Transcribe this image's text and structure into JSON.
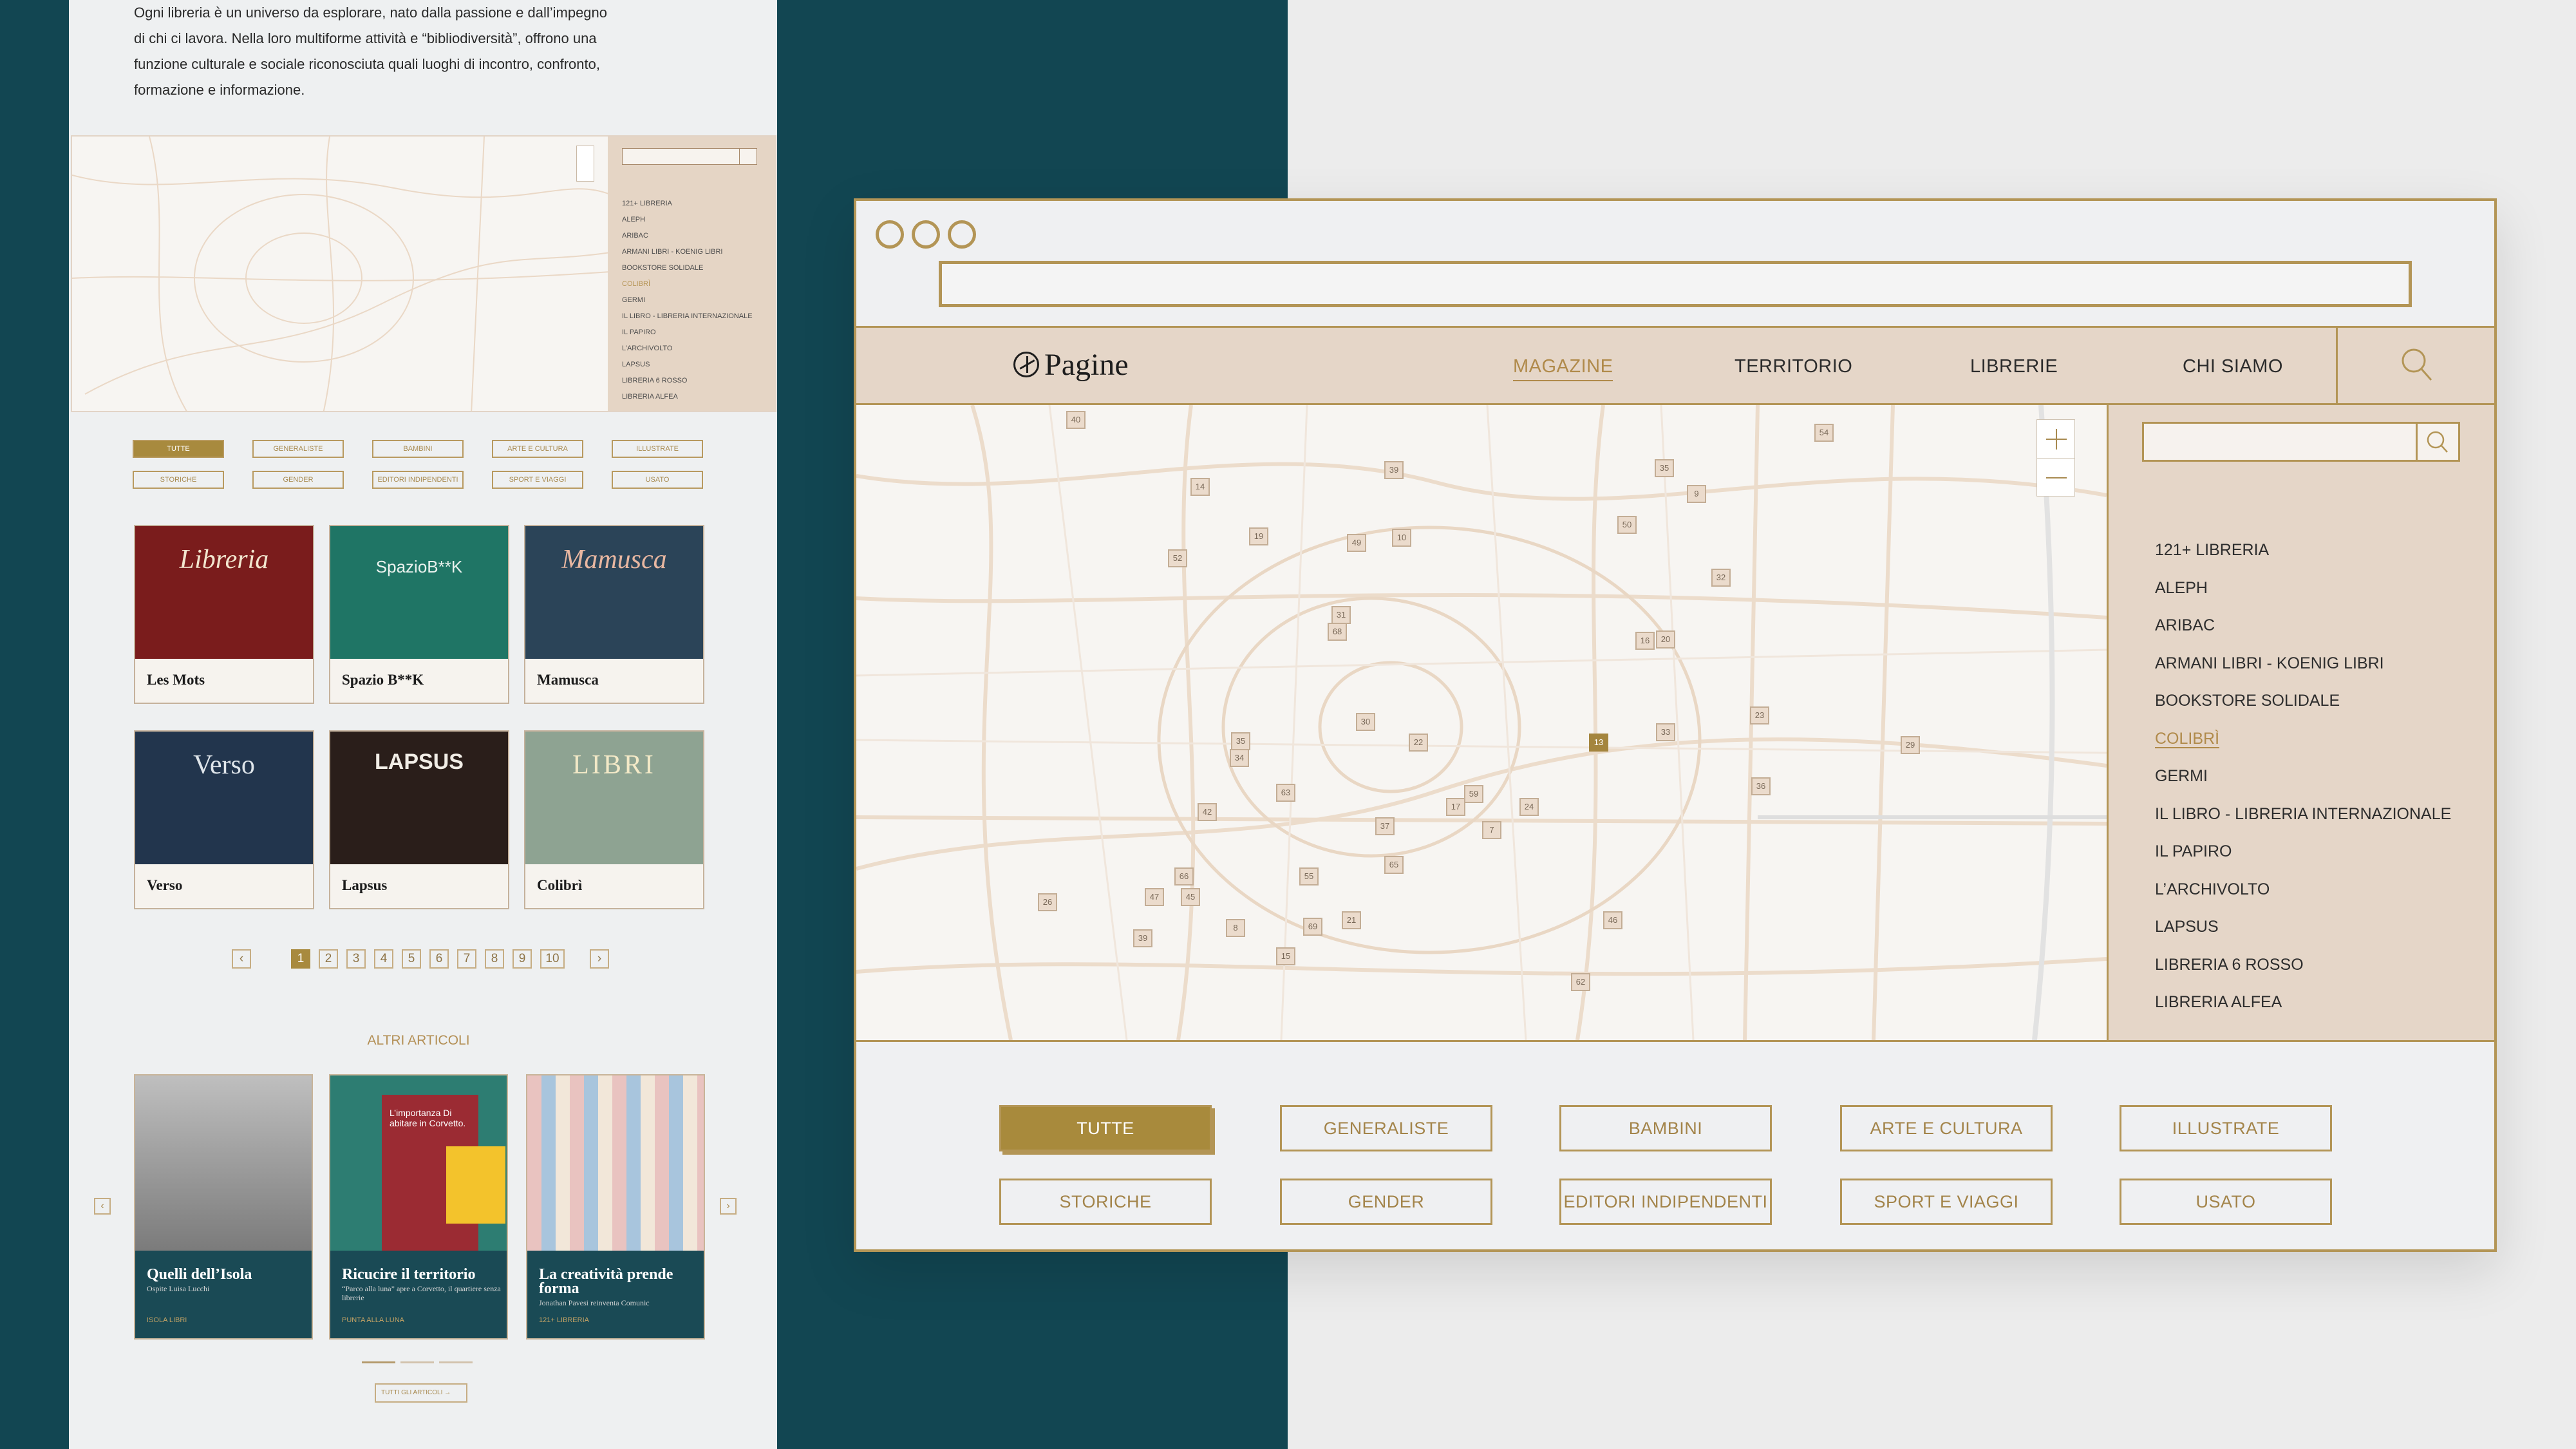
{
  "left": {
    "intro": [
      "Ogni libreria è un universo da esplorare, nato dalla passione e dall’impegno",
      "di chi ci lavora. Nella loro multiforme attività e “bibliodiversità”, offrono una",
      "funzione culturale e sociale riconosciuta quali luoghi di incontro, confronto,",
      "formazione e informazione."
    ],
    "mini_list": [
      "121+ LIBRERIA",
      "ALEPH",
      "ARIBAC",
      "ARMANI LIBRI - KOENIG LIBRI",
      "BOOKSTORE SOLIDALE",
      "COLIBRÌ",
      "GERMI",
      "IL LIBRO - LIBRERIA INTERNAZIONALE",
      "IL PAPIRO",
      "L’ARCHIVOLTO",
      "LAPSUS",
      "LIBRERIA 6 ROSSO",
      "LIBRERIA ALFEA"
    ],
    "mini_categories": [
      "TUTTE",
      "GENERALISTE",
      "BAMBINI",
      "ARTE E CULTURA",
      "ILLUSTRATE",
      "STORICHE",
      "GENDER",
      "EDITORI INDIPENDENTI",
      "SPORT E VIAGGI",
      "USATO"
    ],
    "cards": [
      {
        "title": "Les Mots",
        "sign": "Libreria"
      },
      {
        "title": "Spazio B**K",
        "sign": "SpazioB**K"
      },
      {
        "title": "Mamusca",
        "sign": "Mamusca"
      },
      {
        "title": "Verso",
        "sign": "Verso"
      },
      {
        "title": "Lapsus",
        "sign": "LAPSUS"
      },
      {
        "title": "Colibrì",
        "sign": "LIBRI"
      }
    ],
    "pages": [
      "1",
      "2",
      "3",
      "4",
      "5",
      "6",
      "7",
      "8",
      "9",
      "10"
    ],
    "altri_label": "ALTRI ARTICOLI",
    "articles": [
      {
        "title": "Quelli dell’Isola",
        "sub": "Ospite Luisa Lucchi",
        "tag": "ISOLA LIBRI"
      },
      {
        "title": "Ricucire il territorio",
        "sub": "“Parco alla luna” apre a Corvetto, il quartiere senza librerie",
        "tag": "PUNTA ALLA LUNA",
        "overlay": "L’importanza Di abitare in Corvetto."
      },
      {
        "title": "La creatività prende forma",
        "sub": "Jonathan Pavesi reinventa Comunic",
        "tag": "121+ LIBRERIA"
      }
    ],
    "all_label": "TUTTI GLI ARTICOLI"
  },
  "browser": {
    "logo": "Pagine",
    "nav": [
      "MAGAZINE",
      "TERRITORIO",
      "LIBRERIE",
      "CHI SIAMO"
    ],
    "search_placeholder": "",
    "bookshops": [
      "121+ LIBRERIA",
      "ALEPH",
      "ARIBAC",
      "ARMANI LIBRI - KOENIG LIBRI",
      "BOOKSTORE SOLIDALE",
      "COLIBRÌ",
      "GERMI",
      "IL LIBRO - LIBRERIA INTERNAZIONALE",
      "IL PAPIRO",
      "L’ARCHIVOLTO",
      "LAPSUS",
      "LIBRERIA 6 ROSSO",
      "LIBRERIA ALFEA"
    ],
    "active_bookshop": "COLIBRÌ",
    "filters": [
      "TUTTE",
      "GENERALISTE",
      "BAMBINI",
      "ARTE E CULTURA",
      "ILLUSTRATE",
      "STORICHE",
      "GENDER",
      "EDITORI INDIPENDENTI",
      "SPORT E VIAGGI",
      "USATO"
    ],
    "active_filter": "TUTTE",
    "markers": [
      "40",
      "54",
      "14",
      "39",
      "35",
      "9",
      "52",
      "19",
      "49",
      "10",
      "50",
      "32",
      "31",
      "68",
      "16",
      "20",
      "30",
      "22",
      "13",
      "33",
      "23",
      "29",
      "35",
      "34",
      "63",
      "17",
      "59",
      "24",
      "36",
      "42",
      "37",
      "7",
      "65",
      "66",
      "55",
      "47",
      "45",
      "8",
      "21",
      "69",
      "46",
      "26",
      "39",
      "15",
      "62"
    ],
    "selected_marker": "13"
  },
  "colors": {
    "teal": "#124652",
    "gold": "#b39556",
    "sand": "#e5d6c8"
  }
}
